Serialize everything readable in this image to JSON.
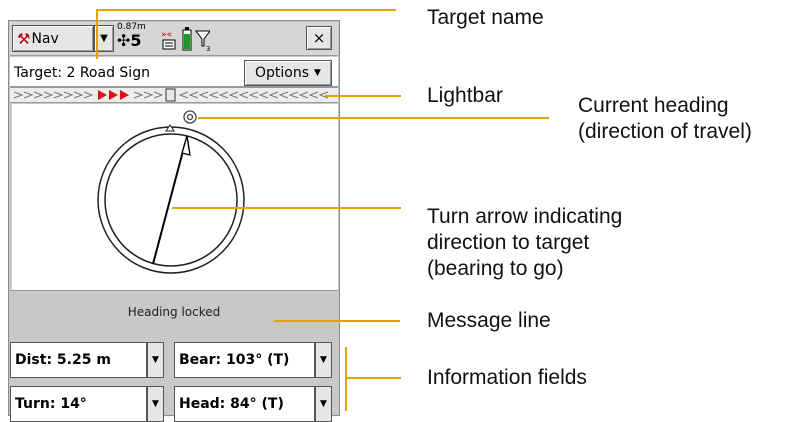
{
  "toolbar": {
    "mode_label": "Nav",
    "mode_icon": "crossed-tools-icon",
    "precision": "0.87m",
    "satellites": "5",
    "filter_subscript": "3",
    "close_label": "×"
  },
  "target": {
    "label": "Target: 2 Road Sign",
    "options_label": "Options"
  },
  "message": {
    "text": "Heading locked"
  },
  "fields": {
    "dist": "Dist: 5.25 m",
    "bear": "Bear: 103° (T)",
    "turn": "Turn: 14°",
    "head": "Head: 84° (T)"
  },
  "callouts": {
    "target_name": "Target name",
    "lightbar": "Lightbar",
    "current_heading_line1": "Current heading",
    "current_heading_line2": "(direction of travel)",
    "turn_arrow_line1": "Turn arrow indicating",
    "turn_arrow_line2": "direction to target",
    "turn_arrow_line3": "(bearing to go)",
    "message_line": "Message line",
    "info_fields": "Information fields"
  },
  "colors": {
    "leader_lines": "#e0a300",
    "lightbar_arrows": "#e01010",
    "screen_background": "#c9c9c9"
  }
}
